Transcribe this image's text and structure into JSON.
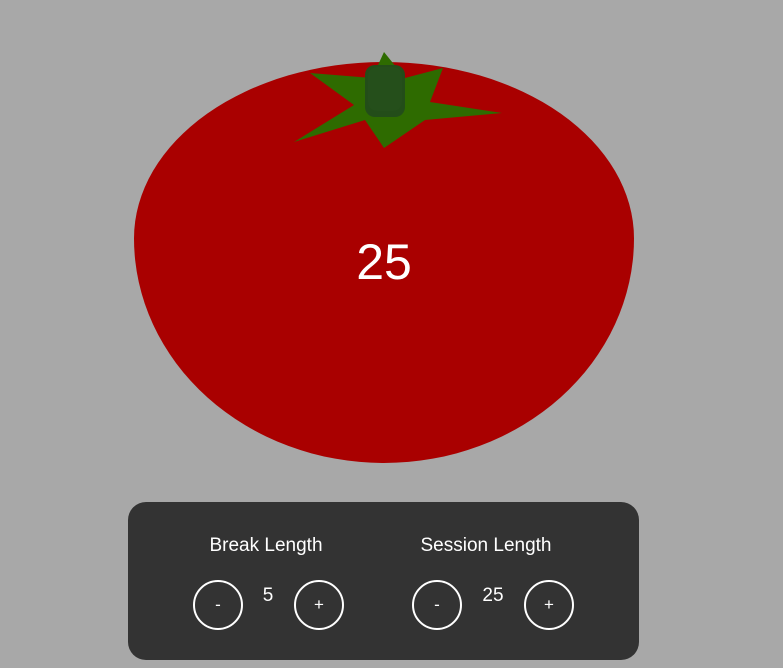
{
  "timer": {
    "display": "25"
  },
  "colors": {
    "background": "#a8a8a8",
    "tomato": "#a90000",
    "leaves": "#2e6b00",
    "stem": "#234d19",
    "panel": "#333333",
    "text": "#ffffff"
  },
  "controls": {
    "break": {
      "label": "Break Length",
      "value": "5",
      "decrement_label": "-",
      "increment_label": "+"
    },
    "session": {
      "label": "Session Length",
      "value": "25",
      "decrement_label": "-",
      "increment_label": "+"
    }
  }
}
